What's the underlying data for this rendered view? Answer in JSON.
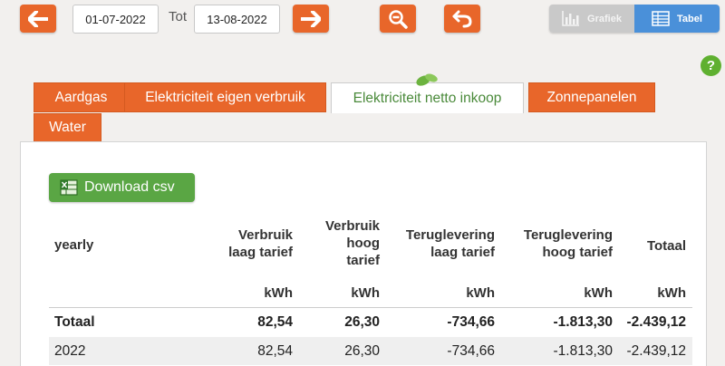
{
  "toolbar": {
    "date_from": "01-07-2022",
    "tot_label": "Tot",
    "date_to": "13-08-2022",
    "view_grafiek": "Grafiek",
    "view_tabel": "Tabel",
    "help": "?"
  },
  "tabs": [
    {
      "label": "Aardgas",
      "active": false
    },
    {
      "label": "Elektriciteit eigen verbruik",
      "active": false
    },
    {
      "label": "Elektriciteit netto inkoop",
      "active": true
    },
    {
      "label": "Zonnepanelen",
      "active": false
    },
    {
      "label": "Water",
      "active": false
    }
  ],
  "download_label": "Download csv",
  "table": {
    "period_header": "yearly",
    "columns": [
      {
        "lines": [
          "Verbruik",
          "laag tarief"
        ],
        "unit": "kWh"
      },
      {
        "lines": [
          "Verbruik",
          "hoog",
          "tarief"
        ],
        "unit": "kWh"
      },
      {
        "lines": [
          "Teruglevering",
          "laag tarief"
        ],
        "unit": "kWh"
      },
      {
        "lines": [
          "Teruglevering",
          "hoog tarief"
        ],
        "unit": "kWh"
      },
      {
        "lines": [
          "Totaal"
        ],
        "unit": "kWh"
      }
    ],
    "rows": [
      {
        "label": "Totaal",
        "values": [
          "82,54",
          "26,30",
          "-734,66",
          "-1.813,30",
          "-2.439,12"
        ],
        "bold": true
      },
      {
        "label": "2022",
        "values": [
          "82,54",
          "26,30",
          "-734,66",
          "-1.813,30",
          "-2.439,12"
        ],
        "bold": false
      }
    ]
  },
  "colors": {
    "accent": "#e8662a",
    "green": "#5aa644",
    "blue": "#4a90d9"
  }
}
